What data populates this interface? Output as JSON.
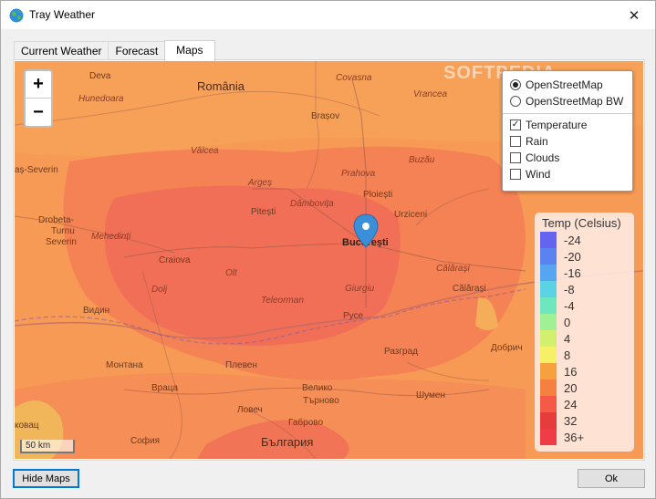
{
  "window": {
    "title": "Tray Weather",
    "close_glyph": "✕",
    "app_icon": "globe-icon"
  },
  "tabs": [
    {
      "label": "Current Weather",
      "active": false
    },
    {
      "label": "Forecast",
      "active": false
    },
    {
      "label": "Maps",
      "active": true
    }
  ],
  "map": {
    "zoom_in": "+",
    "zoom_out": "−",
    "watermark": "SOFTPEDIA",
    "scale": "50 km",
    "labels": {
      "deva": "Deva",
      "hunedoara": "Hunedoara",
      "romania": "România",
      "brasov": "Brașov",
      "covasna": "Covasna",
      "vrancea": "Vrancea",
      "severin": "aș-Severin",
      "valcea": "Vâlcea",
      "arges": "Argeș",
      "prahova": "Prahova",
      "buzau": "Buzău",
      "ploiesti": "Ploiești",
      "pitesti": "Pitești",
      "dambovita": "Dâmbovița",
      "urziceni": "Urziceni",
      "drobeta": "Drobeta-",
      "turnu": "Turnu",
      "severin2": "Severin",
      "mehedinti": "Mehedinți",
      "bucuresti": "București",
      "calarasi_it": "Călărași",
      "craiova": "Craiova",
      "olt": "Olt",
      "dolj": "Dolj",
      "giurgiu": "Giurgiu",
      "calarasi": "Călărași",
      "teleorman": "Teleorman",
      "vidin": "Видин",
      "ruse": "Русе",
      "dobrich": "Добрич",
      "razgrad": "Разград",
      "montana": "Монтана",
      "pleven": "Плевен",
      "vratsa": "Враца",
      "lovech": "Ловеч",
      "gabrovo": "Габрово",
      "shumen": "Шумен",
      "tarnovo": "Търново",
      "sofia": "София",
      "bulgaria": "България",
      "kovac": "ковац",
      "veliko": "Велико"
    },
    "base_color": "#f79a55"
  },
  "layers": {
    "base": [
      {
        "label": "OpenStreetMap",
        "selected": true
      },
      {
        "label": "OpenStreetMap BW",
        "selected": false
      }
    ],
    "overlays": [
      {
        "label": "Temperature",
        "checked": true,
        "mark": "✓"
      },
      {
        "label": "Rain",
        "checked": false,
        "mark": ""
      },
      {
        "label": "Clouds",
        "checked": false,
        "mark": ""
      },
      {
        "label": "Wind",
        "checked": false,
        "mark": ""
      }
    ]
  },
  "legend": {
    "title": "Temp (Celsius)",
    "items": [
      {
        "label": "-24",
        "color": "#6464f0"
      },
      {
        "label": "-20",
        "color": "#5a82f0"
      },
      {
        "label": "-16",
        "color": "#55a5f0"
      },
      {
        "label": "-8",
        "color": "#5cd2e6"
      },
      {
        "label": "-4",
        "color": "#6ee6be"
      },
      {
        "label": "0",
        "color": "#a0f096"
      },
      {
        "label": "4",
        "color": "#d2f06e"
      },
      {
        "label": "8",
        "color": "#f5f064"
      },
      {
        "label": "16",
        "color": "#f7a040"
      },
      {
        "label": "20",
        "color": "#f58040"
      },
      {
        "label": "24",
        "color": "#f55a46"
      },
      {
        "label": "32",
        "color": "#e63c3c"
      },
      {
        "label": "36+",
        "color": "#f03c46"
      }
    ]
  },
  "buttons": {
    "hide_maps": "Hide Maps",
    "ok": "Ok"
  }
}
